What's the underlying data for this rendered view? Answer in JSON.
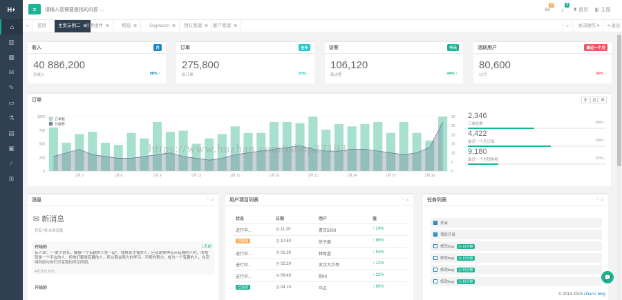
{
  "brand": "H+",
  "sidebar": {
    "items": [
      {
        "icon": "home-icon",
        "glyph": "⌂",
        "active": true
      },
      {
        "icon": "columns-icon",
        "glyph": "▥"
      },
      {
        "icon": "chart-icon",
        "glyph": "▦"
      },
      {
        "icon": "envelope-icon",
        "glyph": "✉"
      },
      {
        "icon": "edit-icon",
        "glyph": "✎"
      },
      {
        "icon": "desktop-icon",
        "glyph": "▭"
      },
      {
        "icon": "flask-icon",
        "glyph": "⚗"
      },
      {
        "icon": "table-icon",
        "glyph": "▤"
      },
      {
        "icon": "picture-icon",
        "glyph": "▣"
      },
      {
        "icon": "magic-icon",
        "glyph": "⁄"
      },
      {
        "icon": "sitemap-icon",
        "glyph": "⊞"
      }
    ]
  },
  "header": {
    "search_placeholder": "请输入您需要查找的内容 …",
    "mail_badge": "16",
    "bell_badge": "8",
    "theme_label": "主题",
    "home_label": "首页"
  },
  "tabs": {
    "items": [
      "首页",
      "主页示例二",
      "通用组件",
      "按钮",
      "Glyphicon",
      "团队管理",
      "客户管理"
    ],
    "active_index": 1,
    "tab_ops": "关闭操作",
    "logout": "退出"
  },
  "stats": [
    {
      "title": "收入",
      "tag": "月",
      "tag_color": "#1c84c6",
      "value": "40 886,200",
      "sub": "总收入",
      "pct": "98%",
      "pct_color": "#1c84c6"
    },
    {
      "title": "订单",
      "tag": "全年",
      "tag_color": "#23c6c8",
      "value": "275,800",
      "sub": "新订单",
      "pct": "20%",
      "pct_color": "#23c6c8"
    },
    {
      "title": "访客",
      "tag": "今天",
      "tag_color": "#1ab394",
      "value": "106,120",
      "sub": "新访客",
      "pct": "44%",
      "pct_color": "#1ab394"
    },
    {
      "title": "活跃用户",
      "tag": "最近一个月",
      "tag_color": "#ed5565",
      "value": "80,600",
      "sub": "12月",
      "pct": "38%",
      "pct_color": "#ed5565"
    }
  ],
  "orders_panel": {
    "title": "订单",
    "btns": [
      "天",
      "月",
      "年"
    ],
    "legend": [
      "订单数",
      "付款数"
    ],
    "side": [
      {
        "value": "2,346",
        "label": "订单总数",
        "pct": "48%",
        "fill": 0.48
      },
      {
        "value": "4,422",
        "label": "最近一个月订单",
        "pct": "60%",
        "fill": 0.6
      },
      {
        "value": "9,180",
        "label": "最近一个月销售额",
        "pct": "22%",
        "fill": 0.22
      }
    ]
  },
  "chart_data": {
    "type": "bar",
    "title": "订单",
    "x": [
      "1月1",
      "1月2",
      "1月3",
      "1月4",
      "1月5",
      "1月6",
      "1月7",
      "1月8",
      "1月9",
      "1月10",
      "1月11",
      "1月12",
      "1月13",
      "1月14",
      "1月15",
      "1月16",
      "1月17",
      "1月18",
      "1月19",
      "1月20",
      "1月21",
      "1月22",
      "1月23",
      "1月24",
      "1月25",
      "1月26",
      "1月27",
      "1月28",
      "1月29",
      "1月30",
      "1月31"
    ],
    "x_ticks": [
      "1月 3",
      "1月 6",
      "1月 9",
      "1月 12",
      "1月 15",
      "1月 18",
      "1月 21",
      "1月 24",
      "1月 27",
      "1月 30"
    ],
    "series": [
      {
        "name": "订单数",
        "kind": "bar",
        "axis": "left",
        "color": "#a8e0d0",
        "values": [
          800,
          520,
          680,
          720,
          520,
          480,
          700,
          600,
          900,
          720,
          740,
          500,
          600,
          680,
          820,
          700,
          700,
          900,
          900,
          880,
          1000,
          760,
          860,
          820,
          860,
          900,
          700,
          900,
          700,
          560,
          1000
        ]
      },
      {
        "name": "付款数",
        "kind": "area",
        "axis": "right",
        "color": "#6f7d96",
        "values": [
          8,
          10,
          12,
          9,
          8,
          7,
          7,
          8,
          9,
          10,
          8,
          7,
          6,
          7,
          9,
          10,
          11,
          12,
          13,
          14,
          12,
          11,
          11,
          12,
          12,
          11,
          10,
          9,
          10,
          13,
          27
        ]
      }
    ],
    "y_left": {
      "min": 0,
      "max": 1000,
      "ticks": [
        0,
        250,
        500,
        750,
        1000
      ]
    },
    "y_right": {
      "min": 0,
      "max": 30,
      "ticks": [
        0,
        5,
        10,
        15,
        20,
        25,
        30
      ]
    },
    "grid": true,
    "legend": "top-left"
  },
  "watermark": "https://www.huzhan.com/ishop27193",
  "messages": {
    "title": "消息",
    "new_title": "新消息",
    "new_sub": "您有7条未读消息",
    "author": "开始的",
    "time_ago": "1天前",
    "body": "有人说：“一辈子很长，要跟一个有趣的人在一起”，我想关注我的人，应该是那种有点有趣的人吧，而我就是一个平淡的人，但他们都是有趣的人，所以我会努力的学习，不断的努力，成为一个有趣的人，在空闲时间与你们分享我的所见所闻。",
    "date": "4月11日 8:15",
    "next_author": "开始的"
  },
  "projects": {
    "title": "用户项目列表",
    "cols": [
      "状态",
      "日期",
      "用户",
      "值"
    ],
    "rows": [
      {
        "status": "进行中...",
        "status_tag": false,
        "time": "11:20",
        "user": "青衣5858",
        "value": "24%"
      },
      {
        "status": "已取消",
        "status_tag": true,
        "tag_color": "#f8ac59",
        "time": "10:40",
        "user": "徐子崴",
        "value": "66%"
      },
      {
        "status": "进行中...",
        "status_tag": false,
        "time": "01:30",
        "user": "林宥嘉",
        "value": "54%"
      },
      {
        "status": "进行中...",
        "status_tag": false,
        "time": "02:20",
        "user": "武汉大兵哥",
        "value": "12%"
      },
      {
        "status": "进行中...",
        "status_tag": false,
        "time": "09:40",
        "user": "荆州",
        "value": "22%"
      },
      {
        "status": "已完成",
        "status_tag": true,
        "tag_color": "#1ab394",
        "time": "04:10",
        "user": "马云",
        "value": "66%"
      }
    ]
  },
  "tasks": {
    "title": "任务列表",
    "items": [
      {
        "text": "开会",
        "checked": true,
        "tag": ""
      },
      {
        "text": "项目开发",
        "checked": true,
        "tag": ""
      },
      {
        "text": "修改bug",
        "checked": false,
        "tag": "10分钟"
      },
      {
        "text": "修改bug",
        "checked": false,
        "tag": "10分钟"
      },
      {
        "text": "修改bug",
        "checked": false,
        "tag": "10分钟"
      },
      {
        "text": "修改bug",
        "checked": false,
        "tag": "10分钟"
      }
    ]
  },
  "footer": {
    "copyright": "© 2014-2015",
    "link": "zihan's blog"
  }
}
